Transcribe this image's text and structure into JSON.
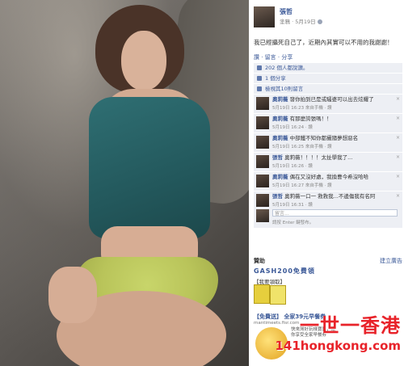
{
  "post": {
    "author": "張哲",
    "meta_label": "塗鴉 · 5月19日",
    "text": "我已經攝死自己了，近期內其實可以不用的我謝謝！",
    "actions": "讚 · 留言 · 分享"
  },
  "ufi": {
    "likes": "202 個人都說讚。",
    "shares": "1 個分享",
    "more_comments": "檢視其10則留言"
  },
  "comments": [
    {
      "name": "奧莉薇",
      "text": "發你拍到已是或騷婆可以出去炫耀了",
      "time": "5月19日 16:23 來自手機 · 讚"
    },
    {
      "name": "奧莉薇",
      "text": "有那麼誇張嗎！！",
      "time": "5月19日 16:24 · 讚"
    },
    {
      "name": "奧莉薇",
      "text": "中部鐵不知你都攝隨夢想惡名",
      "time": "5月19日 16:25 來自手機 · 讚"
    },
    {
      "name": "張哲",
      "text": "奧莉薇！！！！太扯學我了...",
      "time": "5月19日 16:26 · 讚"
    },
    {
      "name": "奧莉薇",
      "text": "偶在又沒好處，我換曹今希沒哈哈",
      "time": "5月19日 16:27 來自手機 · 讚"
    },
    {
      "name": "張哲",
      "text": "奧莉薇一口一 救救我...不邊傷我有名阿",
      "time": "5月19日 16:31 · 讚"
    }
  ],
  "write": {
    "placeholder": "留言...",
    "hint": "請按 Enter 鍵發布。"
  },
  "sponsored": {
    "label": "贊助",
    "create_ad": "建立廣告",
    "ad1_title": "GASH200免費領",
    "ad1_sub": "【我要領取】",
    "ad2_title": "【免費送】 全家39元早餐券",
    "ad2_url": "mantimeets.fisr.com",
    "ad2_text": "快來灣好玩樣寶寶，讓你享受全家早餐券"
  },
  "watermark": {
    "big": "一世一香港",
    "small": "141hongkong.com"
  }
}
